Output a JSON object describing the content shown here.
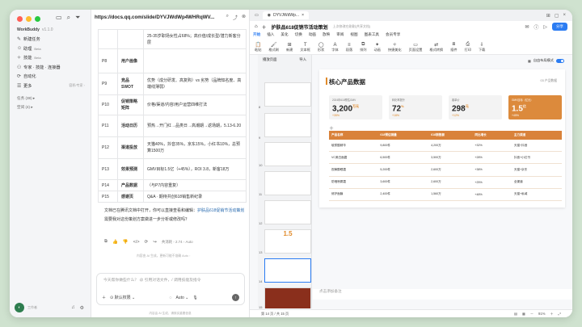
{
  "sidebar": {
    "brand": "WorkBuddy",
    "version": "v1.1.0",
    "nav": [
      {
        "label": "新建任务",
        "icon": "✎"
      },
      {
        "label": "助理",
        "tag": "Beta",
        "icon": "☺"
      },
      {
        "label": "技能",
        "tag": "Beta",
        "icon": "✧"
      },
      {
        "label": "专家 · 技能 · 连接器",
        "icon": "⚇"
      },
      {
        "label": "自动化",
        "icon": "⟳"
      },
      {
        "label": "更多",
        "side": "容积/专家 ◦",
        "icon": "☰"
      }
    ],
    "sections": [
      "任务 (38) ▸",
      "空间 (4) ▸"
    ],
    "user": "工作者"
  },
  "chat": {
    "url": "https://docs.qq.com/slide/DYVJWdWp4WHRqWV...",
    "table": [
      {
        "id": "",
        "name": "",
        "desc": "25-35岁职场女性占68%；高价值/成长型/潜力新客分层"
      },
      {
        "id": "P8",
        "name": "用户画像",
        "desc": ""
      },
      {
        "id": "P9",
        "name": "竞品SWOT",
        "desc": "优势（成分研发、高复购）vs 劣势（品牌知名度、高端线薄弱）"
      },
      {
        "id": "P10",
        "name": "促销策略矩阵",
        "desc": "价格/渠道/内容/用户运营四维打法"
      },
      {
        "id": "P11",
        "name": "活动日历",
        "desc": "预热→开门红→品类日→高潮期→返场期，5.13-6.20"
      },
      {
        "id": "P12",
        "name": "渠道投放",
        "desc": "天猫40%，抖音35%，京东15%，小红书10%，总预算1500万"
      },
      {
        "id": "P13",
        "name": "效果预测",
        "desc": "GMV目标1.5亿（+45%），ROI 3.8，新客18万"
      },
      {
        "id": "P14",
        "name": "产品数据",
        "desc": "（与P7内容重复）"
      },
      {
        "id": "P15",
        "name": "感谢页",
        "desc": "Q&A · 期待共创618销售新纪录"
      }
    ],
    "message_pre": "文档已在腾讯文档中打开，你可以直接查看和编辑：",
    "message_link": "护肤品618促销节活动策划",
    "message_q": "需要我对这份策划方案做进一步分析或修改吗？",
    "meta": "共消耗 ◦ 2.74 ◦ Auto",
    "hint": "内容由 AI 生成，更新可能不准确 Auto ◦",
    "input_placeholder": "今天帮你做些什么？ @ 引用对话文件，/ 调用技能及指令",
    "permission": "默认权限",
    "model": "Auto",
    "footer": "内容由 AI 生成，请核实重要信息"
  },
  "doc": {
    "tab_title": "DYVJWdWp...",
    "title": "护肤品618促销节活动策划",
    "saved": "上次修改在刚刚(共享文档)",
    "share": "分享",
    "menu": [
      "开始",
      "插入",
      "美化",
      "切换",
      "动画",
      "放映",
      "审阅",
      "视图",
      "图表工具",
      "会员专享"
    ],
    "toolbar": [
      "粘贴",
      "格式刷",
      "新建",
      "文本框",
      "形状",
      "字体",
      "段落",
      "排列",
      "动画",
      "快捷美化",
      "页面设置",
      "格式转换",
      "插件",
      "打印",
      "下载"
    ],
    "thumb_tabs": [
      "播放页面",
      "导入"
    ],
    "thumb_numbers": [
      "8",
      "9",
      "10",
      "11",
      "12",
      "13",
      "14",
      "15"
    ],
    "autofit": "自由布局模式",
    "notes_placeholder": "点击添加备注",
    "status_left": "第 14 页 / 共 15 页",
    "zoom": "91%"
  },
  "slide": {
    "title": "核心产品数据",
    "subtitle": "03 产品数据",
    "kpis": [
      {
        "label": "2024年618预估GMV",
        "value": "3,200",
        "unit": "万元",
        "change": "+35%"
      },
      {
        "label": "转化率提升",
        "value": "72",
        "unit": "%",
        "change": "+18%"
      },
      {
        "label": "客单价",
        "value": "298",
        "unit": "元",
        "change": "+12%"
      },
      {
        "label": "GMV目标（亿元）",
        "value": "1.5",
        "unit": "亿",
        "change": "+45%"
      }
    ],
    "table_headers": [
      "产品名称",
      "618预估销量",
      "618销售额",
      "同比增长",
      "主力渠道"
    ],
    "table_rows": [
      [
        "玻尿酸精华",
        "9,800件",
        "4,200万",
        "+32%",
        "天猫+抖音"
      ],
      [
        "VC美白面霜",
        "6,500件",
        "3,500万",
        "+28%",
        "抖音+小红书"
      ],
      [
        "视黄醇眼霜",
        "5,200件",
        "2,600万",
        "+38%",
        "天猫+京东"
      ],
      [
        "防晒喷雾霜",
        "3,600件",
        "2,600万",
        "+25%",
        "全渠道"
      ],
      [
        "修护面膜",
        "2,400件",
        "1,560万",
        "+48%",
        "天猫+私域"
      ]
    ]
  }
}
